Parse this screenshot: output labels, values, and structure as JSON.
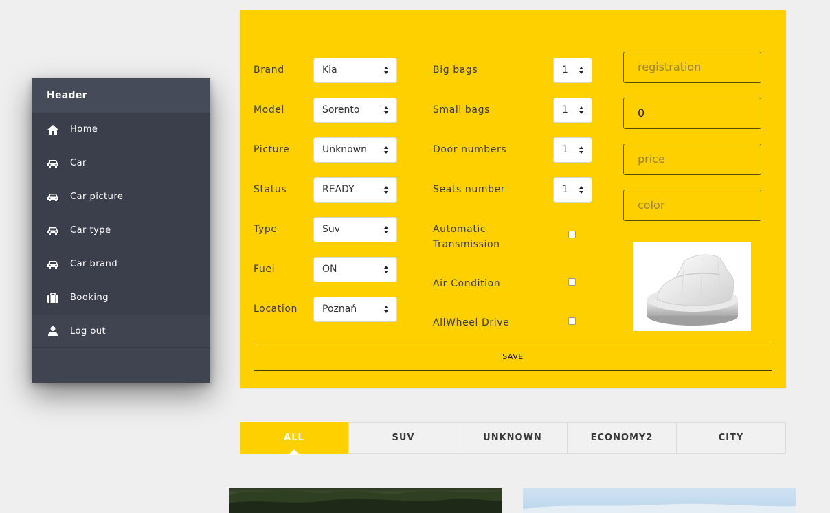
{
  "sidebar": {
    "header": "Header",
    "items": [
      {
        "label": "Home",
        "icon": "home-icon"
      },
      {
        "label": "Car",
        "icon": "car-icon"
      },
      {
        "label": "Car picture",
        "icon": "car-icon"
      },
      {
        "label": "Car type",
        "icon": "car-icon"
      },
      {
        "label": "Car brand",
        "icon": "car-icon"
      },
      {
        "label": "Booking",
        "icon": "suitcase-icon"
      }
    ],
    "logout": {
      "label": "Log out",
      "icon": "user-icon"
    }
  },
  "form": {
    "left": [
      {
        "label": "Brand",
        "value": "Kia"
      },
      {
        "label": "Model",
        "value": "Sorento"
      },
      {
        "label": "Picture",
        "value": "Unknown"
      },
      {
        "label": "Status",
        "value": "READY"
      },
      {
        "label": "Type",
        "value": "Suv"
      },
      {
        "label": "Fuel",
        "value": "ON"
      },
      {
        "label": "Location",
        "value": "Poznań"
      }
    ],
    "counts": [
      {
        "label": "Big bags",
        "value": "1"
      },
      {
        "label": "Small bags",
        "value": "1"
      },
      {
        "label": "Door numbers",
        "value": "1"
      },
      {
        "label": "Seats number",
        "value": "1"
      }
    ],
    "checks": [
      {
        "label1": "Automatic",
        "label2": "Transmission",
        "checked": false
      },
      {
        "label": "Air Condition",
        "checked": false
      },
      {
        "label": "AllWheel Drive",
        "checked": false
      }
    ],
    "inputs": {
      "registration": {
        "placeholder": "registration",
        "value": ""
      },
      "mileage": {
        "placeholder": "",
        "value": "0"
      },
      "price": {
        "placeholder": "price",
        "value": ""
      },
      "color": {
        "placeholder": "color",
        "value": ""
      }
    },
    "save_label": "SAVE"
  },
  "tabs": [
    "ALL",
    "SUV",
    "UNKNOWN",
    "ECONOMY2",
    "CITY"
  ],
  "colors": {
    "accent": "#ffd000",
    "sidebar": "#3f4450"
  }
}
